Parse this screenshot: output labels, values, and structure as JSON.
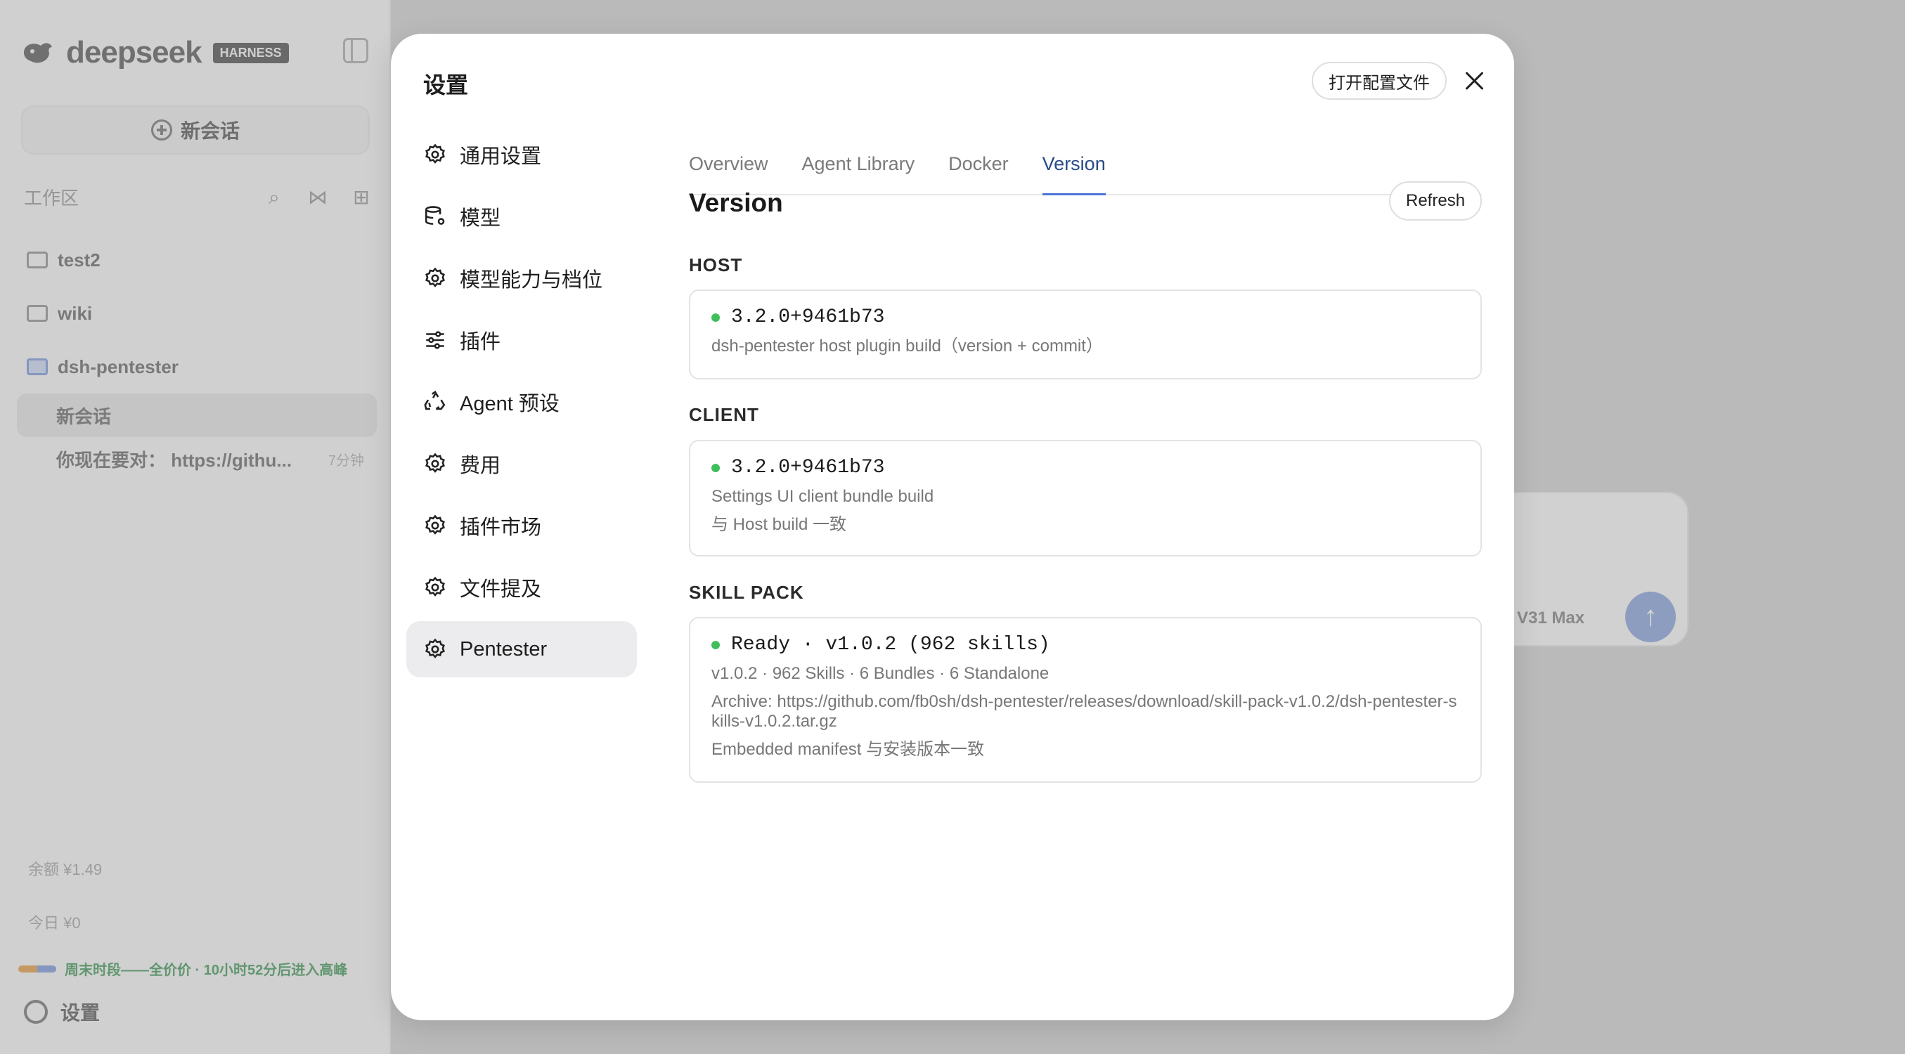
{
  "sidebar": {
    "brand_name": "deepseek",
    "brand_badge": "HARNESS",
    "new_chat_label": "新会话",
    "workspace_label": "工作区",
    "workspaces": [
      {
        "name": "test2"
      },
      {
        "name": "wiki"
      },
      {
        "name": "dsh-pentester"
      }
    ],
    "sessions": [
      {
        "title": "新会话",
        "time": ""
      },
      {
        "title": "你现在要对：  https://githu...",
        "time": "7分钟"
      }
    ],
    "balance": "余额 ¥1.49",
    "today": "今日 ¥0",
    "promo": "周末时段——全价价 · 10小时52分后进入高峰",
    "settings_label": "设置"
  },
  "composer": {
    "model_label": "V31 Max"
  },
  "modal": {
    "title": "设置",
    "open_config_label": "打开配置文件",
    "nav": [
      {
        "label": "通用设置",
        "icon": "gear-icon",
        "active": false
      },
      {
        "label": "模型",
        "icon": "database-gear-icon",
        "active": false
      },
      {
        "label": "模型能力与档位",
        "icon": "gear-icon",
        "active": false
      },
      {
        "label": "插件",
        "icon": "sliders-icon",
        "active": false
      },
      {
        "label": "Agent 预设",
        "icon": "recycle-icon",
        "active": false
      },
      {
        "label": "费用",
        "icon": "gear-icon",
        "active": false
      },
      {
        "label": "插件市场",
        "icon": "gear-icon",
        "active": false
      },
      {
        "label": "文件提及",
        "icon": "gear-icon",
        "active": false
      },
      {
        "label": "Pentester",
        "icon": "gear-icon",
        "active": true
      }
    ],
    "tabs": [
      {
        "label": "Overview",
        "active": false
      },
      {
        "label": "Agent Library",
        "active": false
      },
      {
        "label": "Docker",
        "active": false
      },
      {
        "label": "Version",
        "active": true
      }
    ],
    "section_title": "Version",
    "refresh_label": "Refresh",
    "host": {
      "label": "HOST",
      "version": "3.2.0+9461b73",
      "desc": "dsh-pentester host plugin build（version + commit）"
    },
    "client": {
      "label": "CLIENT",
      "version": "3.2.0+9461b73",
      "desc": "Settings UI client bundle build",
      "note": "与 Host build 一致"
    },
    "skill_pack": {
      "label": "SKILL PACK",
      "status": "Ready · v1.0.2 (962 skills)",
      "summary": "v1.0.2 · 962 Skills · 6 Bundles · 6 Standalone",
      "archive": "Archive: https://github.com/fb0sh/dsh-pentester/releases/download/skill-pack-v1.0.2/dsh-pentester-skills-v1.0.2.tar.gz",
      "manifest": "Embedded manifest 与安装版本一致"
    }
  },
  "colors": {
    "status_ok": "#3fbf5b",
    "tab_accent": "#4874d6"
  }
}
